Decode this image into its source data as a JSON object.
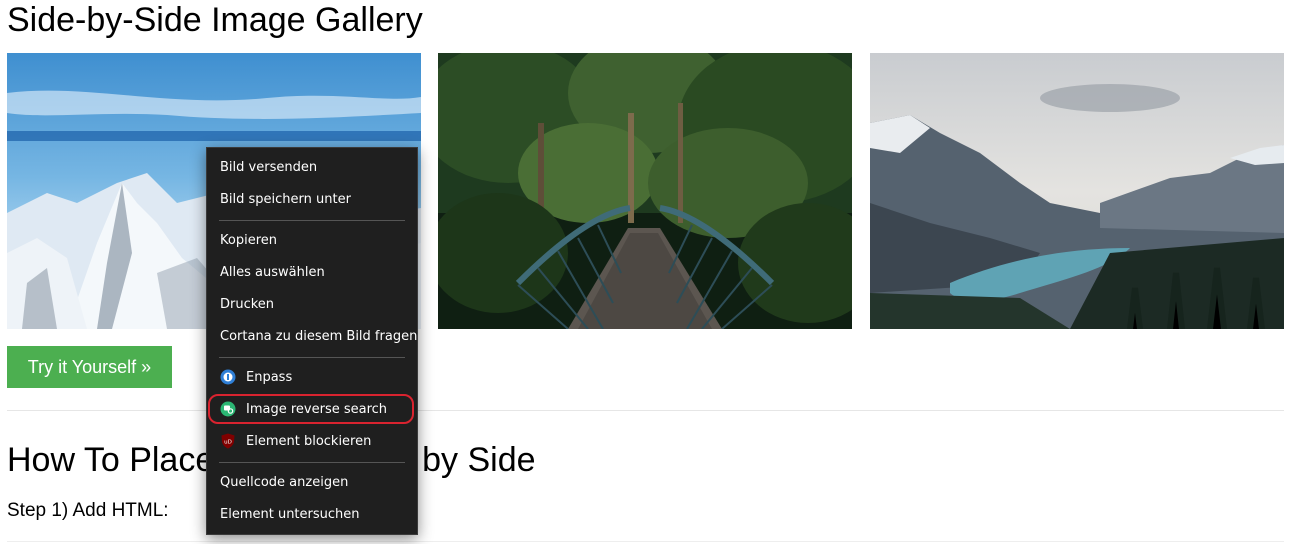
{
  "page": {
    "title": "Side-by-Side Image Gallery",
    "try_button": "Try it Yourself »",
    "section_heading": "How To Place Images Side by Side",
    "step_text": "Step 1) Add HTML:"
  },
  "images": [
    {
      "name": "mountains-image"
    },
    {
      "name": "bridge-image"
    },
    {
      "name": "lake-image"
    }
  ],
  "context_menu": {
    "items": [
      {
        "label": "Bild versenden"
      },
      {
        "label": "Bild speichern unter"
      },
      {
        "label": "Kopieren"
      },
      {
        "label": "Alles auswählen"
      },
      {
        "label": "Drucken"
      },
      {
        "label": "Cortana zu diesem Bild fragen"
      },
      {
        "label": "Enpass",
        "icon": "enpass-icon"
      },
      {
        "label": "Image reverse search",
        "icon": "reverse-search-icon"
      },
      {
        "label": "Element blockieren",
        "icon": "ublock-icon",
        "icon_text": "uD"
      },
      {
        "label": "Quellcode anzeigen"
      },
      {
        "label": "Element untersuchen"
      }
    ]
  },
  "colors": {
    "accent_button": "#4caf50",
    "menu_background": "#1f1f1f",
    "highlight_border": "#d9232f"
  }
}
